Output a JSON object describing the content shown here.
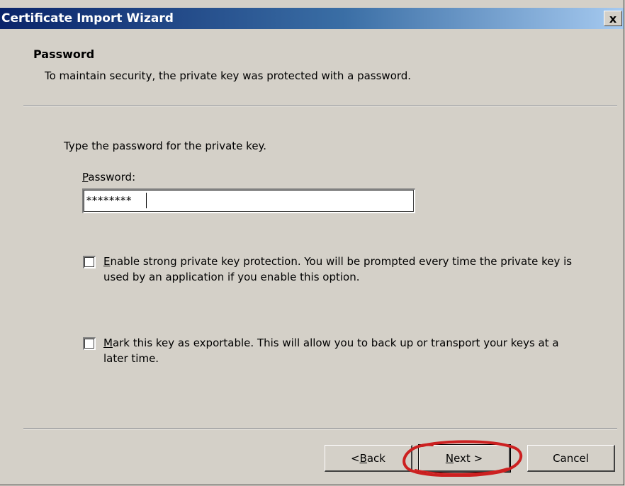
{
  "window": {
    "title": "Certificate Import Wizard",
    "close_glyph": "x"
  },
  "header": {
    "title": "Password",
    "subtitle": "To maintain security, the private key was protected with a password."
  },
  "main": {
    "instruction": "Type the password for the private key.",
    "password": {
      "label_access": "P",
      "label_rest": "assword:",
      "value": "********"
    },
    "options": [
      {
        "access": "E",
        "text_rest": "nable strong private key protection. You will be prompted every time the private key is used by an application if you enable this option.",
        "checked": false
      },
      {
        "access": "M",
        "text_rest": "ark this key as exportable. This will allow you to back up or transport your keys at a later time.",
        "checked": false
      }
    ]
  },
  "buttons": {
    "back_prefix": "< ",
    "back_access": "B",
    "back_rest": "ack",
    "next_access": "N",
    "next_rest": "ext >",
    "cancel": "Cancel"
  },
  "annotation": {
    "ring_color": "#cc2020"
  }
}
